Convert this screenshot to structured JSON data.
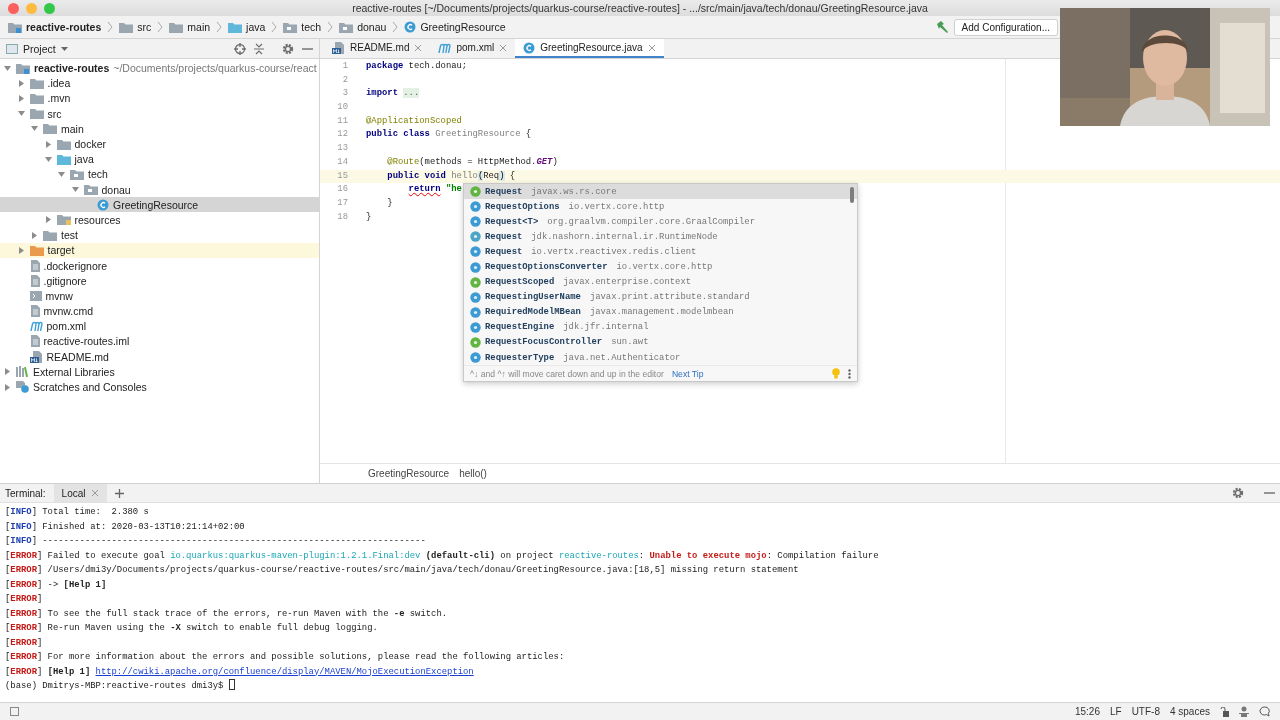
{
  "window": {
    "title": "reactive-routes [~/Documents/projects/quarkus-course/reactive-routes] - .../src/main/java/tech/donau/GreetingResource.java"
  },
  "navbar": {
    "breadcrumbs": [
      {
        "label": "reactive-routes",
        "kind": "module"
      },
      {
        "label": "src",
        "kind": "folder"
      },
      {
        "label": "main",
        "kind": "folder"
      },
      {
        "label": "java",
        "kind": "source"
      },
      {
        "label": "tech",
        "kind": "package"
      },
      {
        "label": "donau",
        "kind": "package"
      },
      {
        "label": "GreetingResource",
        "kind": "class"
      }
    ],
    "run_config": "Add Configuration..."
  },
  "project": {
    "title": "Project",
    "tree": [
      {
        "label": "reactive-routes",
        "path": "~/Documents/projects/quarkus-course/react",
        "kind": "module",
        "expanded": true,
        "selected": false,
        "highlighted": false,
        "children": [
          {
            "label": ".idea",
            "kind": "folder",
            "expanded": false,
            "selected": false,
            "highlighted": false
          },
          {
            "label": ".mvn",
            "kind": "folder",
            "expanded": false,
            "selected": false,
            "highlighted": false
          },
          {
            "label": "src",
            "kind": "folder",
            "expanded": true,
            "selected": false,
            "highlighted": false,
            "children": [
              {
                "label": "main",
                "kind": "folder",
                "expanded": true,
                "selected": false,
                "highlighted": false,
                "children": [
                  {
                    "label": "docker",
                    "kind": "folder",
                    "expanded": false,
                    "selected": false,
                    "highlighted": false
                  },
                  {
                    "label": "java",
                    "kind": "source",
                    "expanded": true,
                    "selected": false,
                    "highlighted": false,
                    "children": [
                      {
                        "label": "tech",
                        "kind": "package",
                        "expanded": true,
                        "selected": false,
                        "highlighted": false,
                        "children": [
                          {
                            "label": "donau",
                            "kind": "package",
                            "expanded": true,
                            "selected": false,
                            "highlighted": false,
                            "children": [
                              {
                                "label": "GreetingResource",
                                "kind": "class",
                                "selected": true,
                                "highlighted": false
                              }
                            ]
                          }
                        ]
                      }
                    ]
                  },
                  {
                    "label": "resources",
                    "kind": "resources",
                    "expanded": false,
                    "selected": false,
                    "highlighted": false
                  }
                ]
              },
              {
                "label": "test",
                "kind": "folder",
                "expanded": false,
                "selected": false,
                "highlighted": false
              }
            ]
          },
          {
            "label": "target",
            "kind": "excluded",
            "expanded": false,
            "selected": false,
            "highlighted": true
          },
          {
            "label": ".dockerignore",
            "kind": "file",
            "selected": false,
            "highlighted": false
          },
          {
            "label": ".gitignore",
            "kind": "file",
            "selected": false,
            "highlighted": false
          },
          {
            "label": "mvnw",
            "kind": "script",
            "selected": false,
            "highlighted": false
          },
          {
            "label": "mvnw.cmd",
            "kind": "file",
            "selected": false,
            "highlighted": false
          },
          {
            "label": "pom.xml",
            "kind": "maven",
            "selected": false,
            "highlighted": false
          },
          {
            "label": "reactive-routes.iml",
            "kind": "file",
            "selected": false,
            "highlighted": false
          },
          {
            "label": "README.md",
            "kind": "markdown",
            "selected": false,
            "highlighted": false
          }
        ]
      },
      {
        "label": "External Libraries",
        "kind": "libraries",
        "expanded": false,
        "selected": false,
        "highlighted": false
      },
      {
        "label": "Scratches and Consoles",
        "kind": "scratches",
        "expanded": false,
        "selected": false,
        "highlighted": false
      }
    ]
  },
  "editor": {
    "tabs": [
      {
        "label": "README.md",
        "kind": "markdown",
        "selected": false
      },
      {
        "label": "pom.xml",
        "kind": "maven",
        "selected": false
      },
      {
        "label": "GreetingResource.java",
        "kind": "class",
        "selected": true
      }
    ],
    "lines": [
      {
        "number": "1",
        "current": false,
        "tokens": [
          {
            "text": "package",
            "kind": "kw"
          },
          {
            "text": " tech.donau;",
            "kind": "plain"
          }
        ]
      },
      {
        "number": "2",
        "current": false
      },
      {
        "number": "3",
        "current": false,
        "tokens": [
          {
            "text": "import",
            "kind": "kw"
          },
          {
            "text": " ...",
            "kind": "fold"
          }
        ]
      },
      {
        "number": "10",
        "current": false
      },
      {
        "number": "11",
        "current": false,
        "tokens": [
          {
            "text": "@ApplicationScoped",
            "kind": "ann"
          }
        ]
      },
      {
        "number": "12",
        "current": false,
        "tokens": [
          {
            "text": "public class",
            "kind": "kw"
          },
          {
            "text": " GreetingResource",
            "kind": "unused"
          },
          {
            "text": " {",
            "kind": "plain"
          }
        ]
      },
      {
        "number": "13",
        "current": false
      },
      {
        "number": "14",
        "current": false,
        "tokens": [
          {
            "text": "    @Route",
            "kind": "ann"
          },
          {
            "text": "(methods = HttpMethod.",
            "kind": "plain"
          },
          {
            "text": "GET",
            "kind": "field"
          },
          {
            "text": ")",
            "kind": "plain"
          }
        ]
      },
      {
        "number": "15",
        "current": true,
        "tokens": [
          {
            "text": "    public void",
            "kind": "kw"
          },
          {
            "text": " hello",
            "kind": "unused"
          },
          {
            "text": "(",
            "kind": "brace"
          },
          {
            "text": "Req",
            "kind": "plain"
          },
          {
            "text": ")",
            "kind": "brace"
          },
          {
            "text": " {",
            "kind": "plain"
          }
        ]
      },
      {
        "number": "16",
        "current": false,
        "tokens": [
          {
            "text": "        return",
            "kind": "err"
          },
          {
            "text": " \"he",
            "kind": "str"
          }
        ]
      },
      {
        "number": "17",
        "current": false,
        "tokens": [
          {
            "text": "    }",
            "kind": "plain"
          }
        ]
      },
      {
        "number": "18",
        "current": false,
        "tokens": [
          {
            "text": "}",
            "kind": "plain"
          }
        ]
      }
    ],
    "completion": {
      "items": [
        {
          "name": "Request",
          "package": "javax.ws.rs.core",
          "kind": "interface",
          "selected": true
        },
        {
          "name": "RequestOptions",
          "package": "io.vertx.core.http",
          "kind": "class",
          "selected": false
        },
        {
          "name": "Request<T>",
          "package": "org.graalvm.compiler.core.GraalCompiler",
          "kind": "class",
          "selected": false
        },
        {
          "name": "Request",
          "package": "jdk.nashorn.internal.ir.RuntimeNode",
          "kind": "enum",
          "selected": false
        },
        {
          "name": "Request",
          "package": "io.vertx.reactivex.redis.client",
          "kind": "class",
          "selected": false
        },
        {
          "name": "RequestOptionsConverter",
          "package": "io.vertx.core.http",
          "kind": "class",
          "selected": false
        },
        {
          "name": "RequestScoped",
          "package": "javax.enterprise.context",
          "kind": "annotation",
          "selected": false
        },
        {
          "name": "RequestingUserName",
          "package": "javax.print.attribute.standard",
          "kind": "class",
          "selected": false
        },
        {
          "name": "RequiredModelMBean",
          "package": "javax.management.modelmbean",
          "kind": "class",
          "selected": false
        },
        {
          "name": "RequestEngine",
          "package": "jdk.jfr.internal",
          "kind": "class",
          "selected": false
        },
        {
          "name": "RequestFocusController",
          "package": "sun.awt",
          "kind": "interface",
          "selected": false
        },
        {
          "name": "RequesterType",
          "package": "java.net.Authenticator",
          "kind": "class",
          "selected": false
        }
      ],
      "hint": "^↓ and ^↑ will move caret down and up in the editor",
      "next_tip": "Next Tip"
    },
    "breadcrumbs": [
      "GreetingResource",
      "hello()"
    ]
  },
  "terminal": {
    "title": "Terminal:",
    "tabs": [
      {
        "label": "Local",
        "selected": true
      }
    ],
    "lines": [
      [
        {
          "text": "[",
          "kind": "p"
        },
        {
          "text": "INFO",
          "kind": "info"
        },
        {
          "text": "] Total time:  2.380 s",
          "kind": "p"
        }
      ],
      [
        {
          "text": "[",
          "kind": "p"
        },
        {
          "text": "INFO",
          "kind": "info"
        },
        {
          "text": "] Finished at: 2020-03-13T10:21:14+02:00",
          "kind": "p"
        }
      ],
      [
        {
          "text": "[",
          "kind": "p"
        },
        {
          "text": "INFO",
          "kind": "info"
        },
        {
          "text": "] ------------------------------------------------------------------------",
          "kind": "p"
        }
      ],
      [
        {
          "text": "[",
          "kind": "p"
        },
        {
          "text": "ERROR",
          "kind": "error"
        },
        {
          "text": "] Failed to execute goal ",
          "kind": "p"
        },
        {
          "text": "io.quarkus:quarkus-maven-plugin:1.2.1.Final:dev",
          "kind": "cyan"
        },
        {
          "text": " (default-cli)",
          "kind": "b"
        },
        {
          "text": " on project ",
          "kind": "p"
        },
        {
          "text": "reactive-routes",
          "kind": "cyan"
        },
        {
          "text": ": ",
          "kind": "p"
        },
        {
          "text": "Unable to execute mojo",
          "kind": "rb"
        },
        {
          "text": ": Compilation failure",
          "kind": "p"
        }
      ],
      [
        {
          "text": "[",
          "kind": "p"
        },
        {
          "text": "ERROR",
          "kind": "error"
        },
        {
          "text": "] /Users/dmi3y/Documents/projects/quarkus-course/reactive-routes/src/main/java/tech/donau/GreetingResource.java:[18,5] missing return statement",
          "kind": "p"
        }
      ],
      [
        {
          "text": "[",
          "kind": "p"
        },
        {
          "text": "ERROR",
          "kind": "error"
        },
        {
          "text": "] -> ",
          "kind": "p"
        },
        {
          "text": "[Help 1]",
          "kind": "b"
        }
      ],
      [
        {
          "text": "[",
          "kind": "p"
        },
        {
          "text": "ERROR",
          "kind": "error"
        },
        {
          "text": "]",
          "kind": "p"
        }
      ],
      [
        {
          "text": "[",
          "kind": "p"
        },
        {
          "text": "ERROR",
          "kind": "error"
        },
        {
          "text": "] To see the full stack trace of the errors, re-run Maven with the ",
          "kind": "p"
        },
        {
          "text": "-e",
          "kind": "b"
        },
        {
          "text": " switch.",
          "kind": "p"
        }
      ],
      [
        {
          "text": "[",
          "kind": "p"
        },
        {
          "text": "ERROR",
          "kind": "error"
        },
        {
          "text": "] Re-run Maven using the ",
          "kind": "p"
        },
        {
          "text": "-X",
          "kind": "b"
        },
        {
          "text": " switch to enable full debug logging.",
          "kind": "p"
        }
      ],
      [
        {
          "text": "[",
          "kind": "p"
        },
        {
          "text": "ERROR",
          "kind": "error"
        },
        {
          "text": "]",
          "kind": "p"
        }
      ],
      [
        {
          "text": "[",
          "kind": "p"
        },
        {
          "text": "ERROR",
          "kind": "error"
        },
        {
          "text": "] For more information about the errors and possible solutions, please read the following articles:",
          "kind": "p"
        }
      ],
      [
        {
          "text": "[",
          "kind": "p"
        },
        {
          "text": "ERROR",
          "kind": "error"
        },
        {
          "text": "] ",
          "kind": "p"
        },
        {
          "text": "[Help 1]",
          "kind": "b"
        },
        {
          "text": " http://cwiki.apache.org/confluence/display/MAVEN/MojoExecutionException",
          "kind": "link"
        }
      ],
      [
        {
          "text": "(base) Dmitrys-MBP:reactive-routes dmi3y$ ",
          "kind": "p"
        },
        {
          "kind": "cursor"
        }
      ]
    ]
  },
  "status_bar": [
    "15:26",
    "LF",
    "UTF-8",
    "4 spaces"
  ],
  "webcam": {
    "kind": "picture"
  }
}
